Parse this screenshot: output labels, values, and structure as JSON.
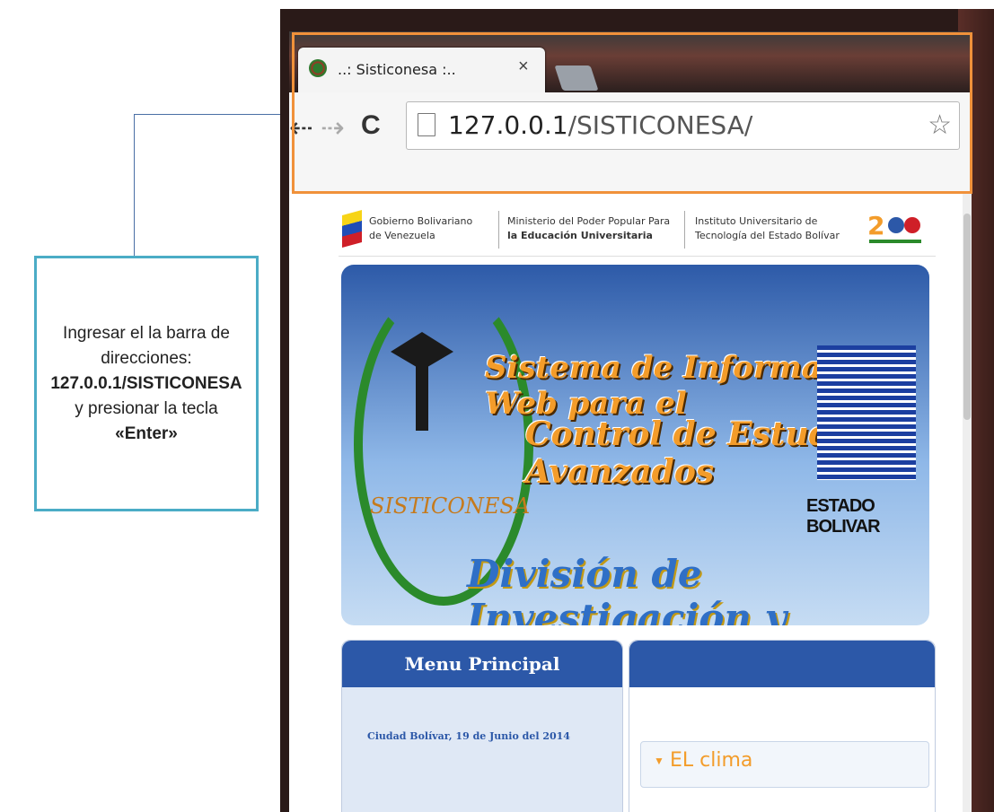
{
  "callout": {
    "line1": "Ingresar el la barra de",
    "line2": "direcciones:",
    "address": "127.0.0.1/SISTICONESA",
    "line3": "y presionar la tecla",
    "key": "«Enter»"
  },
  "browser": {
    "tab_title": "..: Sisticonesa :..",
    "tab_close": "×",
    "url_host": "127.0.0.1",
    "url_path": "/SISTICONESA/"
  },
  "site": {
    "gov_line1": "Gobierno Bolivariano",
    "gov_line2": "de Venezuela",
    "ministry_line1": "Ministerio del Poder Popular Para",
    "ministry_line2": "la Educación Universitaria",
    "institute_line1": "Instituto Universitario de",
    "institute_line2": "Tecnología del Estado Bolívar",
    "banner_title_line1": "Sistema de Información Web para el",
    "banner_title_line2": "Control de Estudios Avanzados",
    "banner_subtitle": "División de Investigación y Postgrado",
    "banner_badge": "SISTICONESA",
    "iut_label": "ESTADO BOLIVAR",
    "menu_title": "Menu Principal",
    "menu_date": "Ciudad Bolívar, 19 de Junio del 2014",
    "clima_label": "EL clima"
  },
  "colors": {
    "highlight_border": "#f0913a",
    "callout_border": "#4bacc6",
    "panel_header": "#2c58a8",
    "accent_orange": "#f39c2a"
  }
}
